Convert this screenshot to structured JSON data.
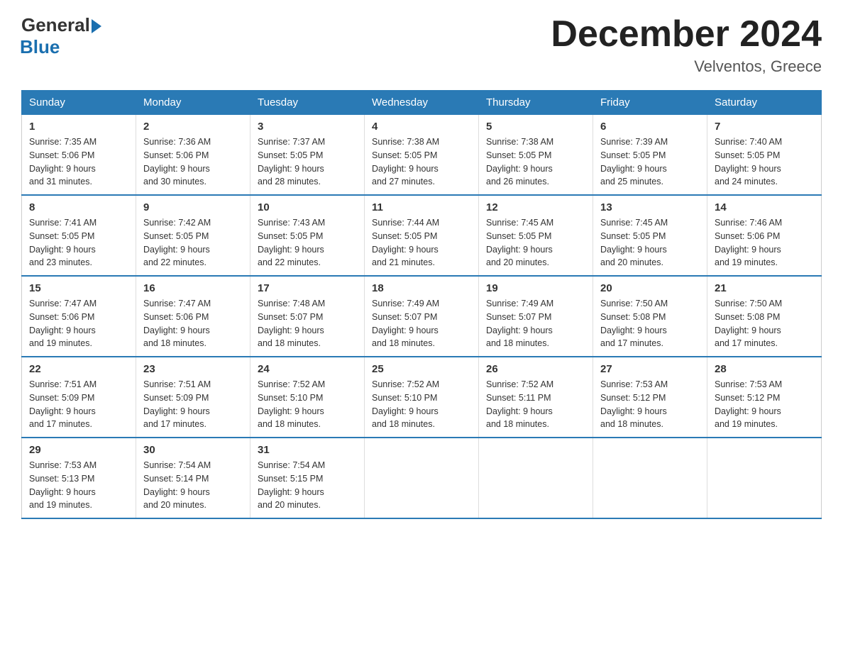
{
  "logo": {
    "general": "General",
    "blue": "Blue"
  },
  "title": "December 2024",
  "location": "Velventos, Greece",
  "headers": [
    "Sunday",
    "Monday",
    "Tuesday",
    "Wednesday",
    "Thursday",
    "Friday",
    "Saturday"
  ],
  "weeks": [
    [
      {
        "num": "1",
        "sunrise": "7:35 AM",
        "sunset": "5:06 PM",
        "daylight": "9 hours and 31 minutes."
      },
      {
        "num": "2",
        "sunrise": "7:36 AM",
        "sunset": "5:06 PM",
        "daylight": "9 hours and 30 minutes."
      },
      {
        "num": "3",
        "sunrise": "7:37 AM",
        "sunset": "5:05 PM",
        "daylight": "9 hours and 28 minutes."
      },
      {
        "num": "4",
        "sunrise": "7:38 AM",
        "sunset": "5:05 PM",
        "daylight": "9 hours and 27 minutes."
      },
      {
        "num": "5",
        "sunrise": "7:38 AM",
        "sunset": "5:05 PM",
        "daylight": "9 hours and 26 minutes."
      },
      {
        "num": "6",
        "sunrise": "7:39 AM",
        "sunset": "5:05 PM",
        "daylight": "9 hours and 25 minutes."
      },
      {
        "num": "7",
        "sunrise": "7:40 AM",
        "sunset": "5:05 PM",
        "daylight": "9 hours and 24 minutes."
      }
    ],
    [
      {
        "num": "8",
        "sunrise": "7:41 AM",
        "sunset": "5:05 PM",
        "daylight": "9 hours and 23 minutes."
      },
      {
        "num": "9",
        "sunrise": "7:42 AM",
        "sunset": "5:05 PM",
        "daylight": "9 hours and 22 minutes."
      },
      {
        "num": "10",
        "sunrise": "7:43 AM",
        "sunset": "5:05 PM",
        "daylight": "9 hours and 22 minutes."
      },
      {
        "num": "11",
        "sunrise": "7:44 AM",
        "sunset": "5:05 PM",
        "daylight": "9 hours and 21 minutes."
      },
      {
        "num": "12",
        "sunrise": "7:45 AM",
        "sunset": "5:05 PM",
        "daylight": "9 hours and 20 minutes."
      },
      {
        "num": "13",
        "sunrise": "7:45 AM",
        "sunset": "5:05 PM",
        "daylight": "9 hours and 20 minutes."
      },
      {
        "num": "14",
        "sunrise": "7:46 AM",
        "sunset": "5:06 PM",
        "daylight": "9 hours and 19 minutes."
      }
    ],
    [
      {
        "num": "15",
        "sunrise": "7:47 AM",
        "sunset": "5:06 PM",
        "daylight": "9 hours and 19 minutes."
      },
      {
        "num": "16",
        "sunrise": "7:47 AM",
        "sunset": "5:06 PM",
        "daylight": "9 hours and 18 minutes."
      },
      {
        "num": "17",
        "sunrise": "7:48 AM",
        "sunset": "5:07 PM",
        "daylight": "9 hours and 18 minutes."
      },
      {
        "num": "18",
        "sunrise": "7:49 AM",
        "sunset": "5:07 PM",
        "daylight": "9 hours and 18 minutes."
      },
      {
        "num": "19",
        "sunrise": "7:49 AM",
        "sunset": "5:07 PM",
        "daylight": "9 hours and 18 minutes."
      },
      {
        "num": "20",
        "sunrise": "7:50 AM",
        "sunset": "5:08 PM",
        "daylight": "9 hours and 17 minutes."
      },
      {
        "num": "21",
        "sunrise": "7:50 AM",
        "sunset": "5:08 PM",
        "daylight": "9 hours and 17 minutes."
      }
    ],
    [
      {
        "num": "22",
        "sunrise": "7:51 AM",
        "sunset": "5:09 PM",
        "daylight": "9 hours and 17 minutes."
      },
      {
        "num": "23",
        "sunrise": "7:51 AM",
        "sunset": "5:09 PM",
        "daylight": "9 hours and 17 minutes."
      },
      {
        "num": "24",
        "sunrise": "7:52 AM",
        "sunset": "5:10 PM",
        "daylight": "9 hours and 18 minutes."
      },
      {
        "num": "25",
        "sunrise": "7:52 AM",
        "sunset": "5:10 PM",
        "daylight": "9 hours and 18 minutes."
      },
      {
        "num": "26",
        "sunrise": "7:52 AM",
        "sunset": "5:11 PM",
        "daylight": "9 hours and 18 minutes."
      },
      {
        "num": "27",
        "sunrise": "7:53 AM",
        "sunset": "5:12 PM",
        "daylight": "9 hours and 18 minutes."
      },
      {
        "num": "28",
        "sunrise": "7:53 AM",
        "sunset": "5:12 PM",
        "daylight": "9 hours and 19 minutes."
      }
    ],
    [
      {
        "num": "29",
        "sunrise": "7:53 AM",
        "sunset": "5:13 PM",
        "daylight": "9 hours and 19 minutes."
      },
      {
        "num": "30",
        "sunrise": "7:54 AM",
        "sunset": "5:14 PM",
        "daylight": "9 hours and 20 minutes."
      },
      {
        "num": "31",
        "sunrise": "7:54 AM",
        "sunset": "5:15 PM",
        "daylight": "9 hours and 20 minutes."
      },
      null,
      null,
      null,
      null
    ]
  ]
}
